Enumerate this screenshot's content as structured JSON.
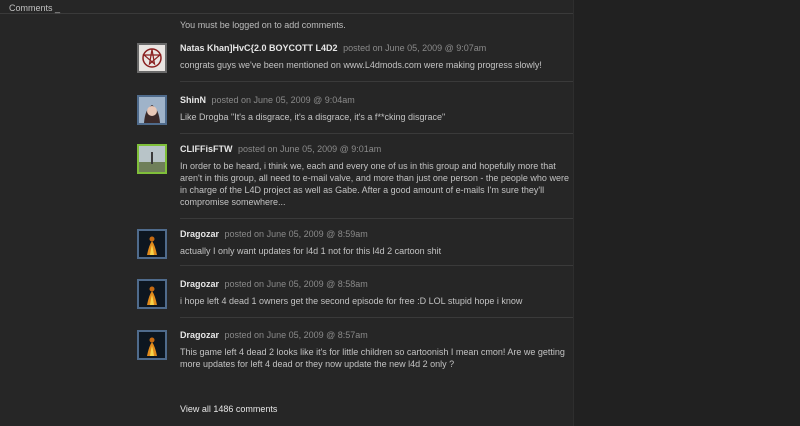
{
  "header": {
    "title": "Comments _"
  },
  "notice": "You must be logged on to add comments.",
  "comments": [
    {
      "author": "Natas Khan]HvC{2.0 BOYCOTT L4D2",
      "posted": "posted on June 05, 2009 @ 9:07am",
      "text": "congrats guys we've been mentioned on www.L4dmods.com were making progress slowly!",
      "avatar_icon": "pentagram-avatar-icon"
    },
    {
      "author": "ShinN",
      "posted": "posted on June 05, 2009 @ 9:04am",
      "text": "Like Drogba \"It's a disgrace, it's a disgrace, it's a f**cking disgrace\"",
      "avatar_icon": "anime-girl-avatar-icon"
    },
    {
      "author": "CLIFFisFTW",
      "posted": "posted on June 05, 2009 @ 9:01am",
      "text": "In order to be heard, i think we, each and every one of us in this group and hopefully more that aren't in this group, all need to e-mail valve, and more than just one person - the people who were in charge of the L4D project as well as Gabe. After a good amount of e-mails I'm sure they'll compromise somewhere...",
      "avatar_icon": "landscape-avatar-icon"
    },
    {
      "author": "Dragozar",
      "posted": "posted on June 05, 2009 @ 8:59am",
      "text": "actually I only want updates for l4d 1 not for this l4d 2 cartoon shit",
      "avatar_icon": "fire-figure-avatar-icon"
    },
    {
      "author": "Dragozar",
      "posted": "posted on June 05, 2009 @ 8:58am",
      "text": "i hope left 4 dead 1 owners get the second episode for free :D LOL stupid hope i know",
      "avatar_icon": "fire-figure-avatar-icon"
    },
    {
      "author": "Dragozar",
      "posted": "posted on June 05, 2009 @ 8:57am",
      "text": "This game left 4 dead 2 looks like it's for little children so cartoonish I mean cmon! Are we getting more updates for left 4 dead or they now update the new l4d 2 only ?",
      "avatar_icon": "fire-figure-avatar-icon"
    }
  ],
  "view_all": "View all 1486 comments",
  "colors": {
    "background": "#262626",
    "author": "#e6e6e6",
    "meta": "#8a8a8a",
    "online_border": "#4f6b8c",
    "ingame_border": "#7fbf3a"
  }
}
